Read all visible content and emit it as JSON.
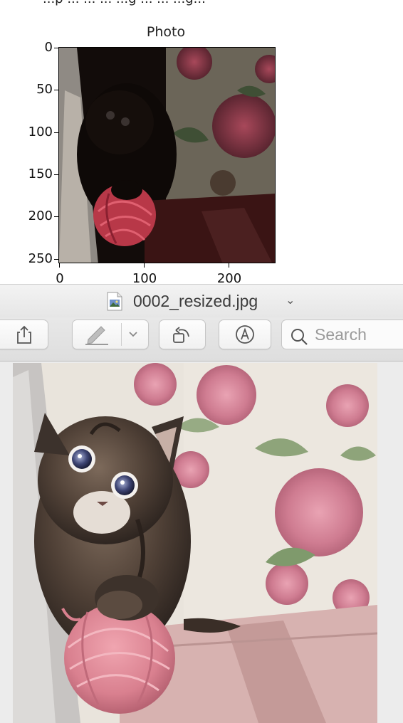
{
  "background_snippet": {
    "clipped_text": "...p ... ... ... ...g ... ... ...g..."
  },
  "figure": {
    "title": "Photo",
    "y_ticks": [
      "0",
      "50",
      "100",
      "150",
      "200",
      "250"
    ],
    "x_ticks": [
      "0",
      "100",
      "200"
    ],
    "image_subject": "kitten with pink yarn ball (dark)"
  },
  "window": {
    "file_name": "0002_resized.jpg",
    "file_icon": "jpeg-file-icon",
    "title_chevron": "⌄"
  },
  "toolbar": {
    "share_icon": "share-icon",
    "markup_icon": "highlighter-pen-icon",
    "markup_menu_icon": "chevron-down-icon",
    "rotate_icon": "rotate-left-icon",
    "annotate_icon": "annotate-circle-icon",
    "search_placeholder": "Search",
    "search_value": ""
  },
  "document": {
    "image_subject": "kitten with pink yarn ball"
  },
  "colors": {
    "window_bg": "#ececec",
    "yarn_pink": "#d98a98",
    "kitten_brown": "#5a4a3e"
  }
}
